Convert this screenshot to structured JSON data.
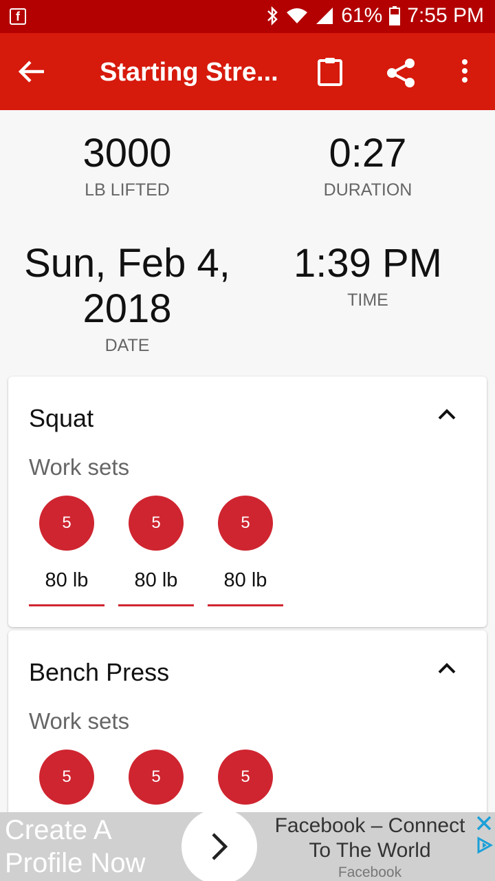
{
  "status_bar": {
    "battery": "61%",
    "time": "7:55 PM"
  },
  "app_bar": {
    "title": "Starting Stre..."
  },
  "stats": {
    "lifted_value": "3000",
    "lifted_label": "LB LIFTED",
    "duration_value": "0:27",
    "duration_label": "DURATION",
    "date_line1": "Sun, Feb 4,",
    "date_line2": "2018",
    "date_label": "DATE",
    "time_value": "1:39 PM",
    "time_label": "TIME"
  },
  "exercises": [
    {
      "name": "Squat",
      "section_label": "Work sets",
      "sets": [
        {
          "reps": "5",
          "weight": "80 lb"
        },
        {
          "reps": "5",
          "weight": "80 lb"
        },
        {
          "reps": "5",
          "weight": "80 lb"
        }
      ]
    },
    {
      "name": "Bench Press",
      "section_label": "Work sets",
      "sets": [
        {
          "reps": "5"
        },
        {
          "reps": "5"
        },
        {
          "reps": "5"
        }
      ]
    }
  ],
  "ad": {
    "left_line1": "Create A",
    "left_line2": "Profile Now",
    "headline_line1": "Facebook – Connect",
    "headline_line2": "To The World",
    "brand": "Facebook"
  },
  "icons": {
    "status": [
      "facebook-icon",
      "bluetooth-icon",
      "wifi-icon",
      "signal-icon",
      "battery-icon"
    ],
    "app_bar": [
      "back-arrow-icon",
      "clipboard-icon",
      "share-icon",
      "more-vert-icon"
    ],
    "card": "chevron-up-icon",
    "ad": [
      "chevron-right-icon",
      "close-icon",
      "adchoices-icon"
    ]
  },
  "colors": {
    "status_bar": "#b30000",
    "app_bar": "#d61a0c",
    "set_circle": "#cf2530"
  }
}
